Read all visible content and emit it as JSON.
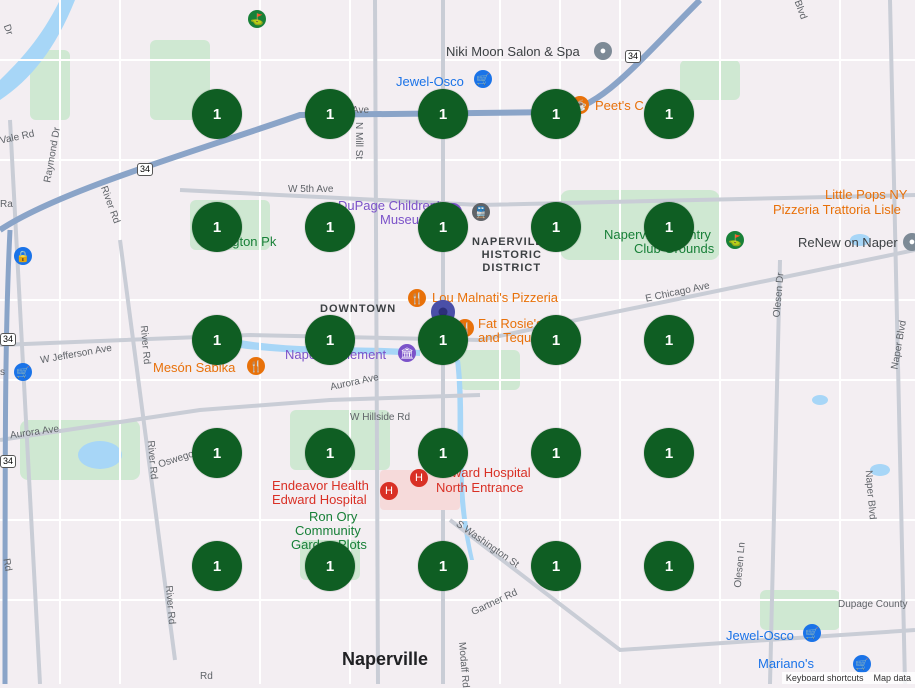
{
  "map": {
    "city_label": "Naperville",
    "district_label_lines": [
      "NAPERVILLE",
      "HISTORIC",
      "DISTRICT"
    ],
    "downtown_label": "DOWNTOWN",
    "pois": {
      "niki_moon": "Niki Moon Salon & Spa",
      "jewel_top": "Jewel-Osco",
      "peets": "Peet's C",
      "little_pops_1": "Little Pops NY",
      "little_pops_2": "Pizzeria Trattoria Lisle",
      "dupage_museum_1": "DuPage Children's",
      "dupage_museum_2": "Museum",
      "naperville_cc_1": "Naperville Country",
      "naperville_cc_2": "Club Grounds",
      "renew": "ReNew on Naper",
      "lou_malnatis": "Lou Malnati's Pizzeria",
      "fat_rosies_1": "Fat Rosie's Taco",
      "fat_rosies_2": "and Tequila",
      "meson_sabika": "Mesón Sabika",
      "naper_settlement": "Naper Settlement",
      "centennial_pk": "ngton Pk",
      "endeavor_1": "Endeavor Health",
      "endeavor_2": "Edward Hospital",
      "edward_north_1": "Edward Hospital",
      "edward_north_2": "North Entrance",
      "ron_ory_1": "Ron Ory",
      "ron_ory_2": "Community",
      "ron_ory_3": "Garden Plots",
      "jewel_bottom": "Jewel-Osco",
      "marianos": "Mariano's"
    },
    "streets": {
      "ave_top": "Ave",
      "mill_st": "N Mill St",
      "w_5th": "W 5th Ave",
      "e_chicago": "E Chicago Ave",
      "w_jefferson": "W Jefferson Ave",
      "aurora_ave_1": "Aurora Ave",
      "aurora_ave_2": "Aurora Ave",
      "w_hillside": "W Hillside Rd",
      "oswego": "Oswego",
      "river_rd_1": "River Rd",
      "river_rd_2": "River Rd",
      "river_rd_3": "River Rd",
      "river_rd_4": "River Rd",
      "river_rd_5": "River Rd",
      "raymond": "Raymond Dr",
      "s_washington": "S Washington St",
      "gartner": "Gartner Rd",
      "modaff": "Modaff Rd",
      "olesen_1": "Olesen Dr",
      "olesen_2": "Olesen Ln",
      "naper_blvd_1": "Naper Blvd",
      "naper_blvd_2": "Naper Blvd",
      "dupage_county": "Dupage County",
      "vale": "Vale Rd",
      "lake_dr": "Dr",
      "rd_frag": "Rd",
      "ra": "Ra",
      "s": "s",
      "blvd_top": "Blvd",
      "rd_bottom": "Rd"
    },
    "highway_shields": [
      "34",
      "34",
      "34",
      "34"
    ],
    "cluster_count_label": "1",
    "attribution": {
      "shortcuts": "Keyboard shortcuts",
      "map_data": "Map data"
    },
    "colors": {
      "cluster": "#0f5e23",
      "pin": "#4a4fa8",
      "highway": "#8aa4c8",
      "park": "#c8e6c9",
      "water": "#9fd3f5"
    }
  }
}
